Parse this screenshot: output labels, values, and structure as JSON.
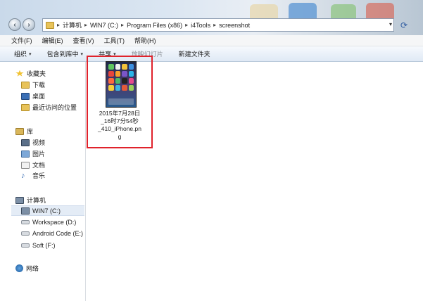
{
  "address": {
    "segments": [
      "计算机",
      "WIN7 (C:)",
      "Program Files (x86)",
      "i4Tools",
      "screenshot"
    ]
  },
  "menu": [
    "文件(F)",
    "编辑(E)",
    "查看(V)",
    "工具(T)",
    "帮助(H)"
  ],
  "commands": [
    {
      "label": "组织",
      "has_dropdown": true,
      "enabled": true
    },
    {
      "label": "包含到库中",
      "has_dropdown": true,
      "enabled": true
    },
    {
      "label": "共享",
      "has_dropdown": true,
      "enabled": true
    },
    {
      "label": "放映幻灯片",
      "has_dropdown": false,
      "enabled": false
    },
    {
      "label": "新建文件夹",
      "has_dropdown": false,
      "enabled": true
    }
  ],
  "nav": {
    "favorites": {
      "label": "收藏夹",
      "items": [
        "下载",
        "桌面",
        "最近访问的位置"
      ]
    },
    "libraries": {
      "label": "库",
      "items": [
        "视频",
        "图片",
        "文档",
        "音乐"
      ]
    },
    "computer": {
      "label": "计算机",
      "items": [
        "WIN7 (C:)",
        "Workspace (D:)",
        "Android Code (E:)",
        "Soft (F:)"
      ],
      "selected": "WIN7 (C:)"
    },
    "network": {
      "label": "网络"
    }
  },
  "file": {
    "name": "2015年7月28日_16时7分54秒_410_iPhone.png",
    "name_lines": [
      "2015年7月28日",
      "_16时7分54秒",
      "_410_iPhone.pn",
      "g"
    ]
  },
  "colors": {
    "highlight_border": "#e0222b",
    "selected_nav": "#e4ecf6"
  }
}
